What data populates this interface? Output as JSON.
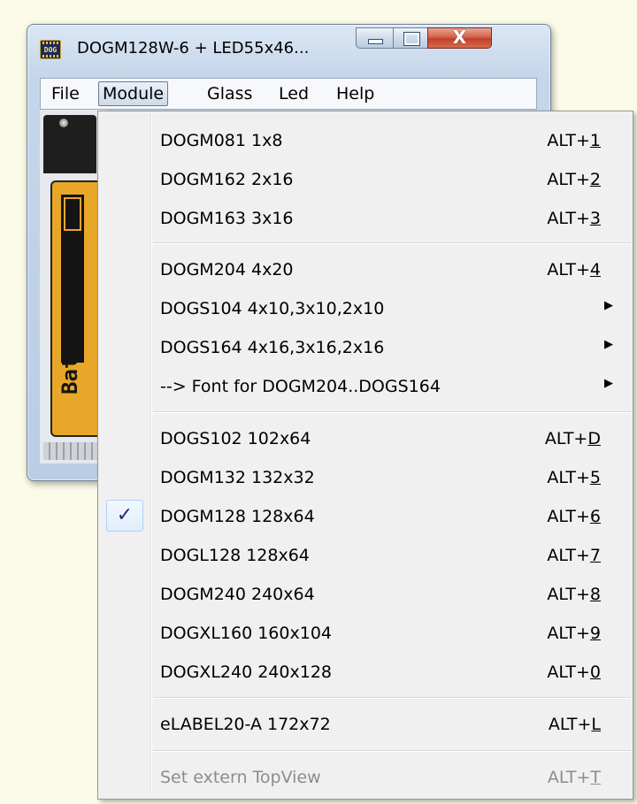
{
  "window": {
    "title": "DOGM128W-6 + LED55x46...",
    "app_icon_text": "DOG",
    "close_glyph": "X"
  },
  "menubar": {
    "items": [
      "File",
      "Module",
      "Glass",
      "Led",
      "Help"
    ],
    "active": "Module"
  },
  "preview": {
    "label": "Bat"
  },
  "module_menu": {
    "groups": [
      [
        {
          "label": "DOGM081  1x8",
          "shortcut_prefix": "ALT+",
          "shortcut_key": "1"
        },
        {
          "label": "DOGM162  2x16",
          "shortcut_prefix": "ALT+",
          "shortcut_key": "2"
        },
        {
          "label": "DOGM163  3x16",
          "shortcut_prefix": "ALT+",
          "shortcut_key": "3"
        }
      ],
      [
        {
          "label": "DOGM204  4x20",
          "shortcut_prefix": "ALT+",
          "shortcut_key": "4"
        },
        {
          "label": "DOGS104  4x10,3x10,2x10",
          "submenu": true
        },
        {
          "label": "DOGS164  4x16,3x16,2x16",
          "submenu": true
        },
        {
          "label": " --> Font for DOGM204..DOGS164",
          "submenu": true
        }
      ],
      [
        {
          "label": "DOGS102  102x64",
          "shortcut_prefix": "ALT+",
          "shortcut_key": "D"
        },
        {
          "label": "DOGM132  132x32",
          "shortcut_prefix": "ALT+",
          "shortcut_key": "5"
        },
        {
          "label": "DOGM128  128x64",
          "shortcut_prefix": "ALT+",
          "shortcut_key": "6",
          "checked": true
        },
        {
          "label": "DOGL128  128x64",
          "shortcut_prefix": "ALT+",
          "shortcut_key": "7"
        },
        {
          "label": "DOGM240  240x64",
          "shortcut_prefix": "ALT+",
          "shortcut_key": "8"
        },
        {
          "label": "DOGXL160 160x104",
          "shortcut_prefix": "ALT+",
          "shortcut_key": "9"
        },
        {
          "label": "DOGXL240 240x128",
          "shortcut_prefix": "ALT+",
          "shortcut_key": "0"
        }
      ],
      [
        {
          "label": "eLABEL20-A 172x72",
          "shortcut_prefix": "ALT+",
          "shortcut_key": "L"
        }
      ],
      [
        {
          "label": "Set extern TopView",
          "shortcut_prefix": "ALT+",
          "shortcut_key": "T",
          "disabled": true
        }
      ]
    ],
    "check_glyph": "✓",
    "submenu_glyph": "▶"
  },
  "colors": {
    "lcd_backlight": "#e8a729",
    "check_mark": "#1b2a8f",
    "disabled_text": "#8c8c8c"
  }
}
